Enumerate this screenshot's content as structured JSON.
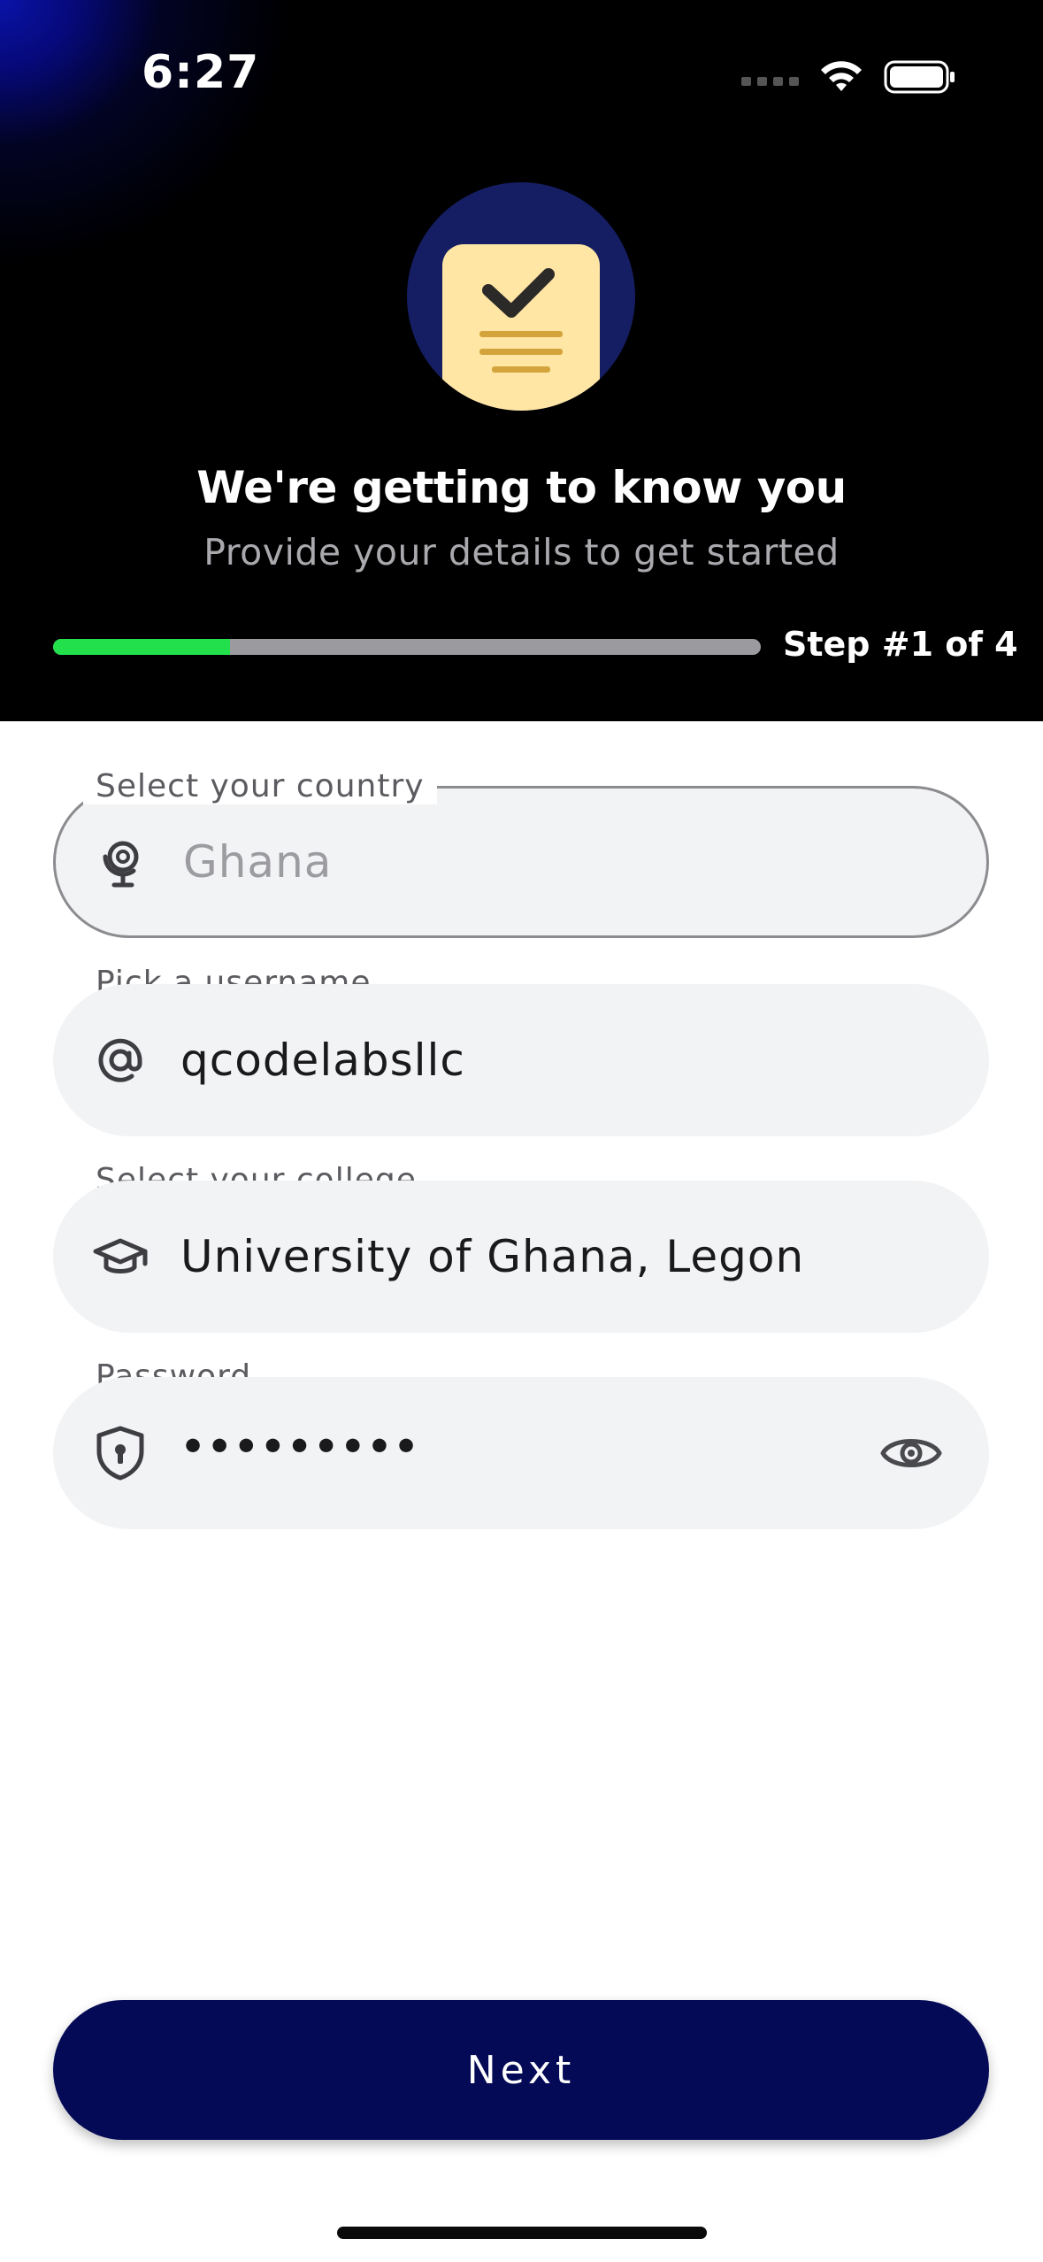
{
  "status_bar": {
    "time": "6:27",
    "icons": [
      "cellular-dots-icon",
      "wifi-icon",
      "battery-icon"
    ]
  },
  "header": {
    "hero_icon": "checklist-note-icon",
    "title": "We're getting to know you",
    "subtitle": "Provide your details to get started",
    "progress_fraction": 0.25,
    "step_label": "Step #1 of 4"
  },
  "form": {
    "country": {
      "label": "Select your country",
      "value": "Ghana",
      "icon": "globe-icon"
    },
    "username": {
      "label": "Pick a username",
      "value": "qcodelabsllc",
      "icon": "at-sign-icon"
    },
    "college": {
      "label": "Select your college",
      "value": "University of Ghana, Legon",
      "icon": "graduation-cap-icon"
    },
    "password": {
      "label": "Password",
      "value": "•••••••••",
      "icon": "shield-lock-icon",
      "toggle_icon": "eye-icon"
    }
  },
  "next_button": {
    "label": "Next"
  },
  "colors": {
    "header_bg": "#000000",
    "progress_fill": "#22e04b",
    "progress_track": "#9a9a9f",
    "button_bg": "#040a55",
    "field_bg": "#f2f3f5"
  }
}
